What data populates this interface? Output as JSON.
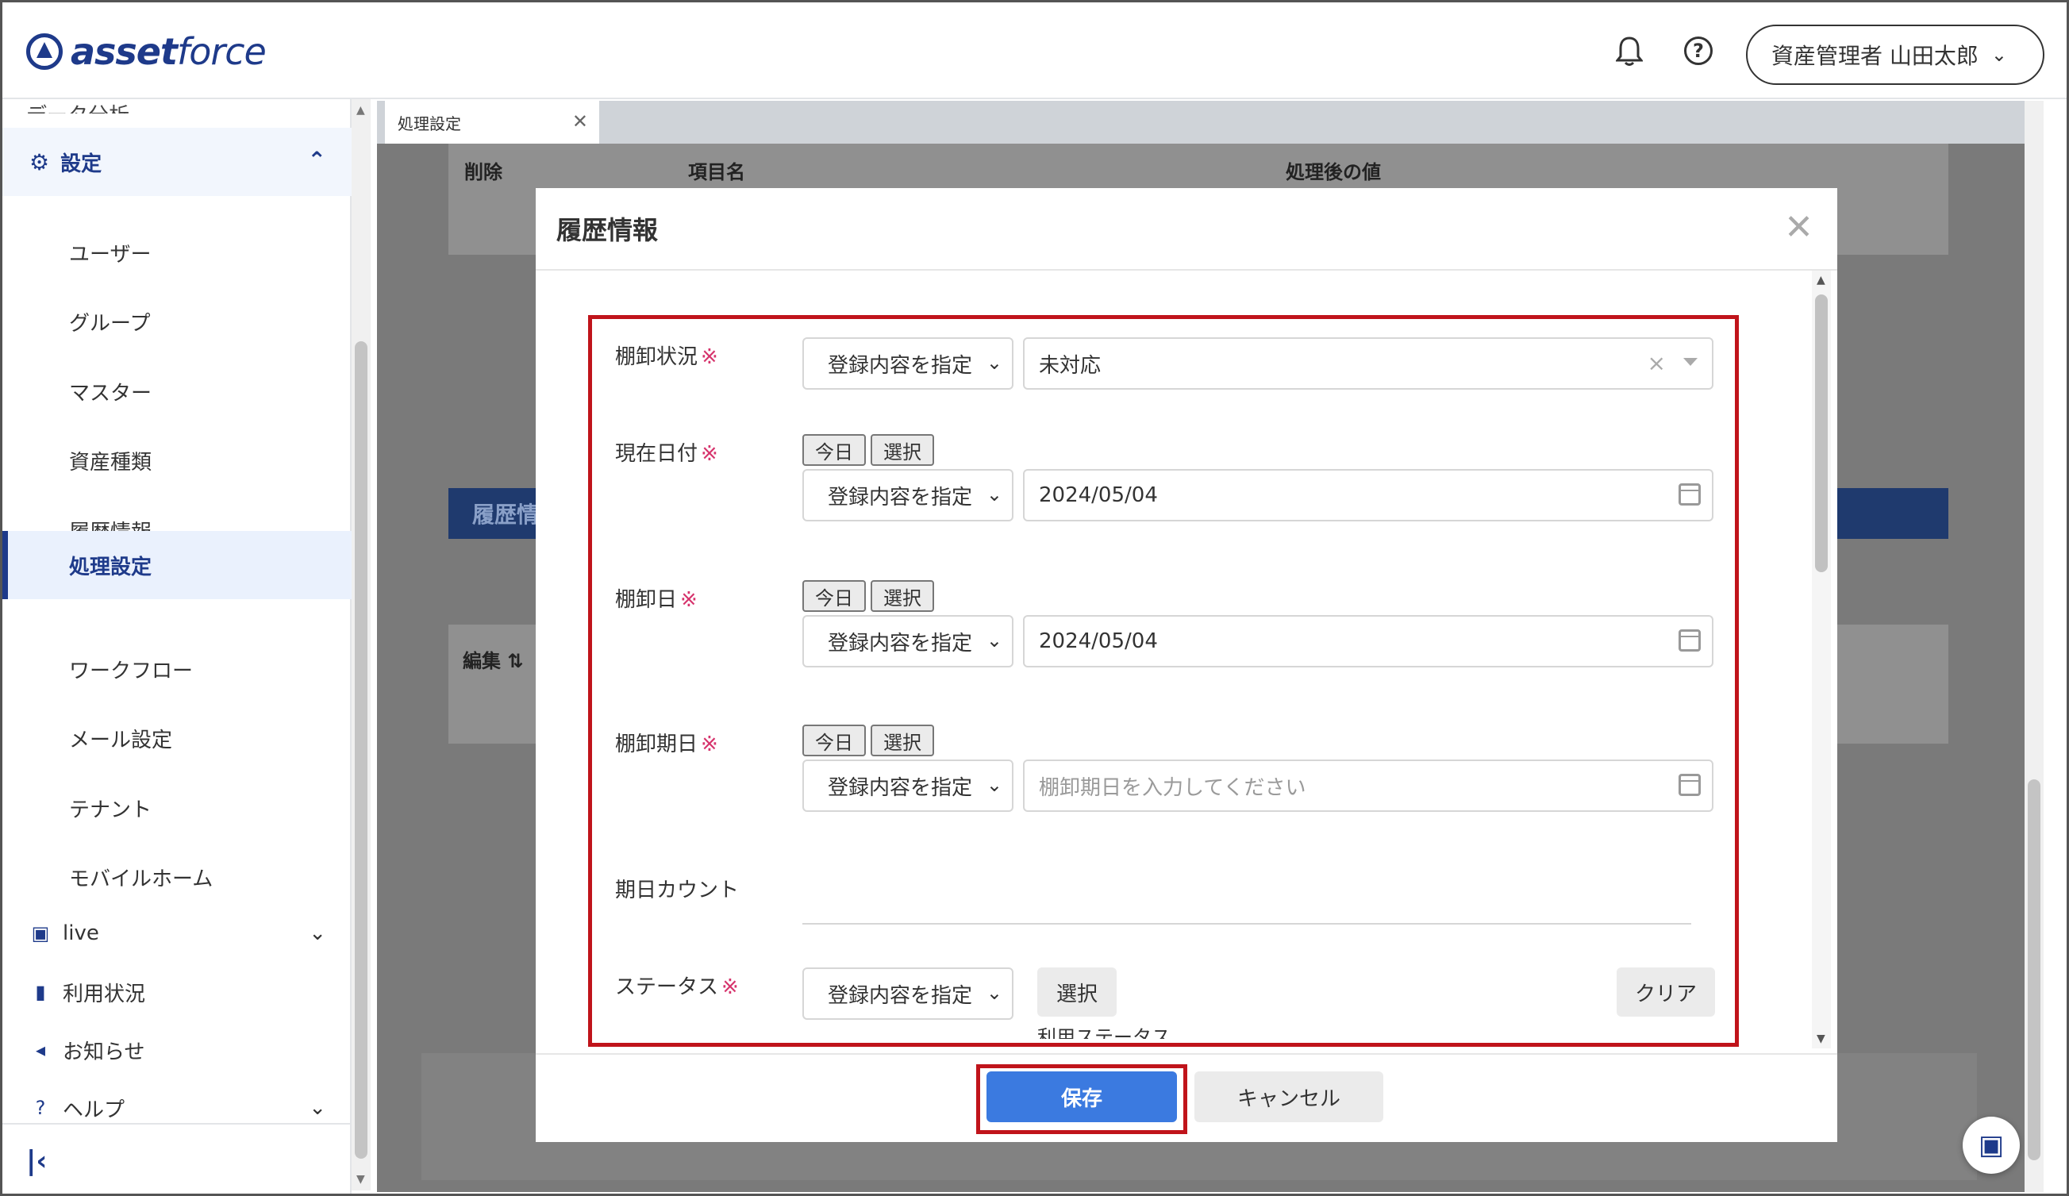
{
  "header": {
    "logo_text_1": "asset",
    "logo_text_2": "force",
    "user_label": "資産管理者 山田太郎"
  },
  "sidebar": {
    "cut_item": "データ分析",
    "section": "設定",
    "items": [
      {
        "label": "ユーザー"
      },
      {
        "label": "グループ"
      },
      {
        "label": "マスター"
      },
      {
        "label": "資産種類"
      },
      {
        "label": "履歴情報"
      },
      {
        "label": "処理設定"
      },
      {
        "label": "ワークフロー"
      },
      {
        "label": "メール設定"
      },
      {
        "label": "テナント"
      },
      {
        "label": "モバイルホーム"
      }
    ],
    "main": [
      {
        "label": "live"
      },
      {
        "label": "利用状況"
      },
      {
        "label": "お知らせ"
      },
      {
        "label": "ヘルプ"
      }
    ]
  },
  "tab": {
    "label": "処理設定"
  },
  "background": {
    "col_delete": "削除",
    "col_item": "項目名",
    "col_after": "処理後の値",
    "blue_header": "履歴情",
    "edit_label": "編集 ⇅"
  },
  "modal": {
    "title": "履歴情報",
    "required_mark": "※",
    "mode_option": "登録内容を指定",
    "today_label": "今日",
    "select_label": "選択",
    "fields": {
      "status_label": "棚卸状況",
      "status_value": "未対応",
      "date_label": "現在日付",
      "date_value": "2024/05/04",
      "inv_date_label": "棚卸日",
      "inv_date_value": "2024/05/04",
      "due_label": "棚卸期日",
      "due_placeholder": "棚卸期日を入力してください",
      "count_label": "期日カウント",
      "st_label": "ステータス",
      "st_select": "選択",
      "st_clear": "クリア",
      "st_sub": "利用ステータス"
    },
    "save_label": "保存",
    "cancel_label": "キャンセル"
  }
}
